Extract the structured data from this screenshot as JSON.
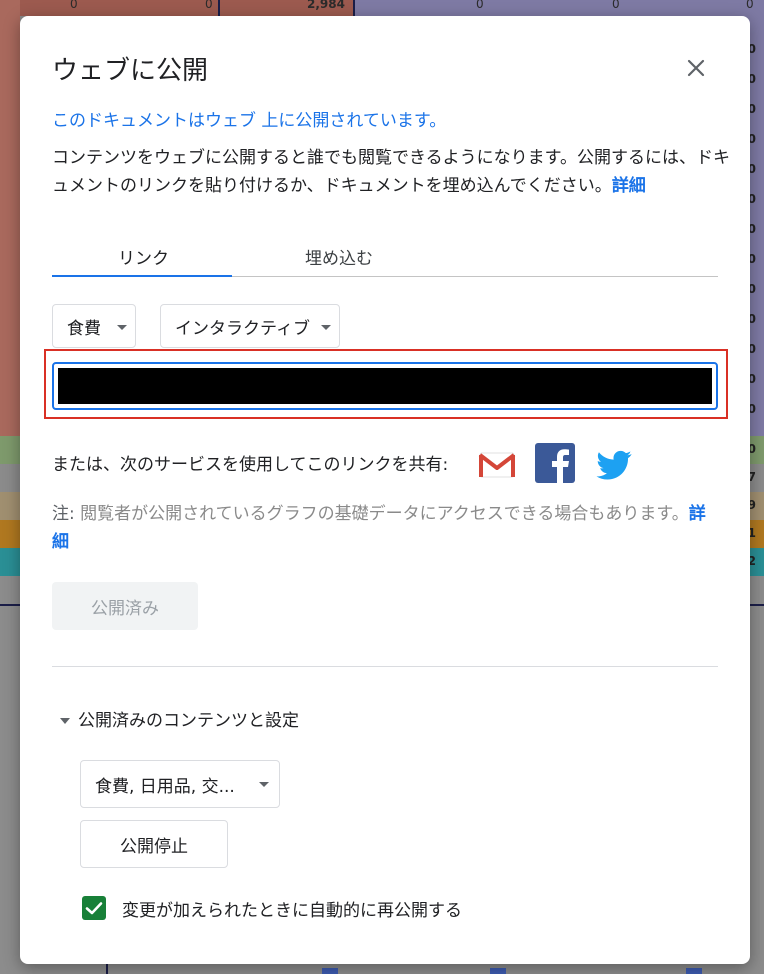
{
  "background": {
    "top_values": [
      "0",
      "0",
      "2,984",
      "0",
      "0",
      "0"
    ],
    "edge_values": [
      "0",
      "0",
      "0",
      "0",
      "0",
      "0",
      "0",
      "0",
      "0",
      "0",
      "0",
      "0",
      "0",
      "0",
      "0",
      "7",
      "9",
      "1",
      "2"
    ]
  },
  "dialog": {
    "title": "ウェブに公開",
    "status_text": "このドキュメントはウェブ 上に公開されています。",
    "description": "コンテンツをウェブに公開すると誰でも閲覧できるようになります。公開するには、ドキュメントのリンクを貼り付けるか、ドキュメントを埋め込んでください。",
    "description_link": "詳細",
    "tabs": [
      "リンク",
      "埋め込む"
    ],
    "sheet_select": "食費",
    "format_select": "インタラクティブ",
    "share_text": "または、次のサービスを使用してこのリンクを共有:",
    "share_icons": [
      "gmail-icon",
      "facebook-icon",
      "twitter-icon"
    ],
    "note_label": "注:",
    "note_text": " 閲覧者が公開されているグラフの基礎データにアクセスできる場合もあります。",
    "note_link": "詳細",
    "published_button": "公開済み",
    "section_title": "公開済みのコンテンツと設定",
    "sheets_select": "食費, 日用品, 交...",
    "stop_button": "公開停止",
    "checkbox_label": "変更が加えられたときに自動的に再公開する",
    "checkbox_checked": true
  },
  "colors": {
    "accent": "#1a73e8",
    "highlight_frame": "#d93025",
    "checkbox": "#188038"
  }
}
